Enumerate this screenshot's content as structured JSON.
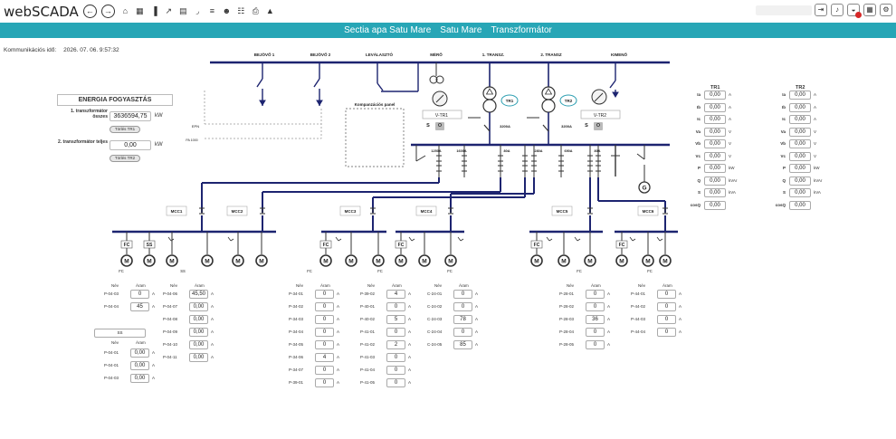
{
  "app": {
    "title": "webSCADA"
  },
  "topbar": {
    "nav_icons": [
      "arrow-left-icon",
      "arrow-right-icon"
    ],
    "tool_icons": [
      "home-icon",
      "calendar-icon",
      "chart-icon",
      "line-chart-icon",
      "table-icon",
      "rss-icon",
      "bars-icon",
      "users-icon",
      "sitemap-icon",
      "print-icon",
      "warning-icon"
    ],
    "right_icons": [
      "logout-icon",
      "volume-icon",
      "bell-icon",
      "grid-icon",
      "gear-icon"
    ]
  },
  "breadcrumb": [
    "Sectia apa Satu Mare",
    "Satu Mare",
    "Transzformátor"
  ],
  "comm": {
    "label": "Kommunikációs idő:",
    "value": "2026. 07. 06. 9:57:32"
  },
  "colors": {
    "accent": "#27a6b6",
    "bus": "#1d2470",
    "line": "#333333",
    "alarm": "#d62828"
  },
  "energy": {
    "title": "ENERGIA FOGYASZTÁS",
    "row1_label": "1. transzformátor összes",
    "row1_value": "3636594,75",
    "row1_unit": "kW",
    "row1_button": "Törlés TR1",
    "row2_label": "2. transzformátor teljes",
    "row2_value": "0,00",
    "row2_unit": "kW",
    "row2_button": "Törlés TR2"
  },
  "diagram": {
    "feeders": [
      "BEJÖVŐ 1",
      "BEJÖVŐ 2",
      "LEVÁLASZTÓ",
      "MÉRŐ",
      "1. TRANSZ.",
      "2. TRANSZ",
      "KIMENŐ"
    ],
    "tr1": "TR1",
    "tr2": "TR2",
    "vtr1": "V-TR1",
    "vtr2": "V-TR2",
    "s_label": "S",
    "o_label": "O",
    "amp_labels": [
      "3200A",
      "3200A",
      "1250A",
      "1600A",
      "80A",
      "280A",
      "690A",
      "600A",
      "80A"
    ],
    "kompenzacios": "Kompanzációs panel",
    "epn": "EPN",
    "pa1000": "PA 1000",
    "mcc": [
      "MCC1",
      "MCC2",
      "MCC3",
      "MCC4",
      "MCC5",
      "MCC6"
    ],
    "fc": "FC",
    "ss": "SS",
    "m": "M",
    "g": "G"
  },
  "tr1_table": {
    "title": "TR1",
    "rows": [
      {
        "label": "Ia",
        "value": "0,00",
        "unit": "A"
      },
      {
        "label": "Ib",
        "value": "0,00",
        "unit": "A"
      },
      {
        "label": "Ic",
        "value": "0,00",
        "unit": "A"
      },
      {
        "label": "Va",
        "value": "0,00",
        "unit": "V"
      },
      {
        "label": "Vb",
        "value": "0,00",
        "unit": "V"
      },
      {
        "label": "Vc",
        "value": "0,00",
        "unit": "V"
      },
      {
        "label": "P",
        "value": "0,00",
        "unit": "kW"
      },
      {
        "label": "Q",
        "value": "0,00",
        "unit": "kVAr"
      },
      {
        "label": "S",
        "value": "0,00",
        "unit": "kVA"
      },
      {
        "label": "cosQ",
        "value": "0,00",
        "unit": ""
      }
    ]
  },
  "tr2_table": {
    "title": "TR2",
    "rows": [
      {
        "label": "Ia",
        "value": "0,00",
        "unit": "A"
      },
      {
        "label": "Ib",
        "value": "0,00",
        "unit": "A"
      },
      {
        "label": "Ic",
        "value": "0,00",
        "unit": "A"
      },
      {
        "label": "Va",
        "value": "0,00",
        "unit": "V"
      },
      {
        "label": "Vb",
        "value": "0,00",
        "unit": "V"
      },
      {
        "label": "Vc",
        "value": "0,00",
        "unit": "V"
      },
      {
        "label": "P",
        "value": "0,00",
        "unit": "kW"
      },
      {
        "label": "Q",
        "value": "0,00",
        "unit": "kVAr"
      },
      {
        "label": "S",
        "value": "0,00",
        "unit": "kVA"
      },
      {
        "label": "cosQ",
        "value": "0,00",
        "unit": ""
      }
    ]
  },
  "table_headers": {
    "name": "Név",
    "current": "Áram",
    "unit": "A"
  },
  "mcc1_fc": {
    "section": "FC",
    "rows": [
      {
        "name": "P-04-03",
        "value": "0"
      },
      {
        "name": "P-04-04",
        "value": "45"
      }
    ]
  },
  "mcc1_ss": {
    "section": "SS",
    "rows": [
      {
        "name": "P-04-06",
        "value": "45,50"
      },
      {
        "name": "P-04-07",
        "value": "0,00"
      },
      {
        "name": "P-04-08",
        "value": "0,00"
      },
      {
        "name": "P-04-09",
        "value": "0,00"
      },
      {
        "name": "P-04-10",
        "value": "0,00"
      },
      {
        "name": "P-04-11",
        "value": "0,00"
      }
    ]
  },
  "mcc2_ss": {
    "section": "SS",
    "rows": [
      {
        "name": "P-04-01",
        "value": "0,00"
      },
      {
        "name": "P-04-01",
        "value": "0,00"
      },
      {
        "name": "P-04-03",
        "value": "0,00"
      }
    ]
  },
  "mcc3_a": {
    "section": "FC",
    "rows": [
      {
        "name": "P-34-01",
        "value": "0"
      },
      {
        "name": "P-34-02",
        "value": "0"
      },
      {
        "name": "P-34-03",
        "value": "0"
      },
      {
        "name": "P-34-04",
        "value": "0"
      },
      {
        "name": "P-34-05",
        "value": "0"
      },
      {
        "name": "P-34-06",
        "value": "4"
      },
      {
        "name": "P-34-07",
        "value": "0"
      },
      {
        "name": "P-39-01",
        "value": "0"
      }
    ]
  },
  "mcc3_b": {
    "section": "FC",
    "rows": [
      {
        "name": "P-39-02",
        "value": "4"
      },
      {
        "name": "P-40-01",
        "value": "0"
      },
      {
        "name": "P-40-02",
        "value": "5"
      },
      {
        "name": "P-41-01",
        "value": "0"
      },
      {
        "name": "P-41-02",
        "value": "2"
      },
      {
        "name": "P-41-03",
        "value": "0"
      },
      {
        "name": "P-41-04",
        "value": "0"
      },
      {
        "name": "P-41-05",
        "value": "0"
      }
    ]
  },
  "mcc4": {
    "section": "FC",
    "rows": [
      {
        "name": "C-24-01",
        "value": "0"
      },
      {
        "name": "C-24-02",
        "value": "0"
      },
      {
        "name": "C-24-03",
        "value": "78"
      },
      {
        "name": "C-24-04",
        "value": "0"
      },
      {
        "name": "C-24-05",
        "value": "85"
      }
    ]
  },
  "mcc5": {
    "section": "FC",
    "rows": [
      {
        "name": "P-28-01",
        "value": "0"
      },
      {
        "name": "P-28-02",
        "value": "0"
      },
      {
        "name": "P-28-03",
        "value": "36"
      },
      {
        "name": "P-28-04",
        "value": "0"
      },
      {
        "name": "P-28-05",
        "value": "0"
      }
    ]
  },
  "mcc6": {
    "section": "FC",
    "rows": [
      {
        "name": "P-44-01",
        "value": "0"
      },
      {
        "name": "P-44-02",
        "value": "0"
      },
      {
        "name": "P-44-03",
        "value": "0"
      },
      {
        "name": "P-44-04",
        "value": "0"
      }
    ]
  }
}
